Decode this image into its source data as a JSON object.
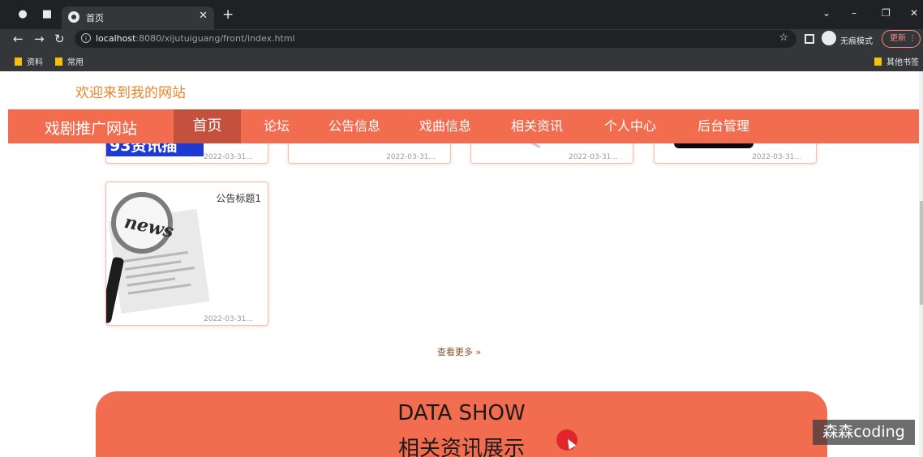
{
  "browser": {
    "tab_title": "首页",
    "url_host": "localhost",
    "url_rest": ":8080/xijutuiguang/front/index.html",
    "incognito_label": "无痕模式",
    "update_label": "更新",
    "bookmarks": [
      "资料",
      "常用"
    ],
    "other_bookmarks": "其他书签"
  },
  "header": {
    "welcome": "欢迎来到我的网站",
    "brand": "戏剧推广网站",
    "nav": [
      "首页",
      "论坛",
      "公告信息",
      "戏曲信息",
      "相关资讯",
      "个人中心",
      "后台管理"
    ]
  },
  "announcements": {
    "cards_top": [
      {
        "date": "2022-03-31...",
        "thumb_text": "93资讯插"
      },
      {
        "date": "2022-03-31..."
      },
      {
        "date": "2022-03-31..."
      },
      {
        "date": "2022-03-31..."
      }
    ],
    "card_news": {
      "title": "公告标题1",
      "date": "2022-03-31...",
      "thumb_text": "news"
    },
    "more_label": "查看更多"
  },
  "section": {
    "title_en": "DATA SHOW",
    "title_cn": "相关资讯展示"
  },
  "watermark": "森森coding",
  "colors": {
    "accent": "#f26d50",
    "nav_active": "#c4513d",
    "welcome": "#e5862c"
  }
}
